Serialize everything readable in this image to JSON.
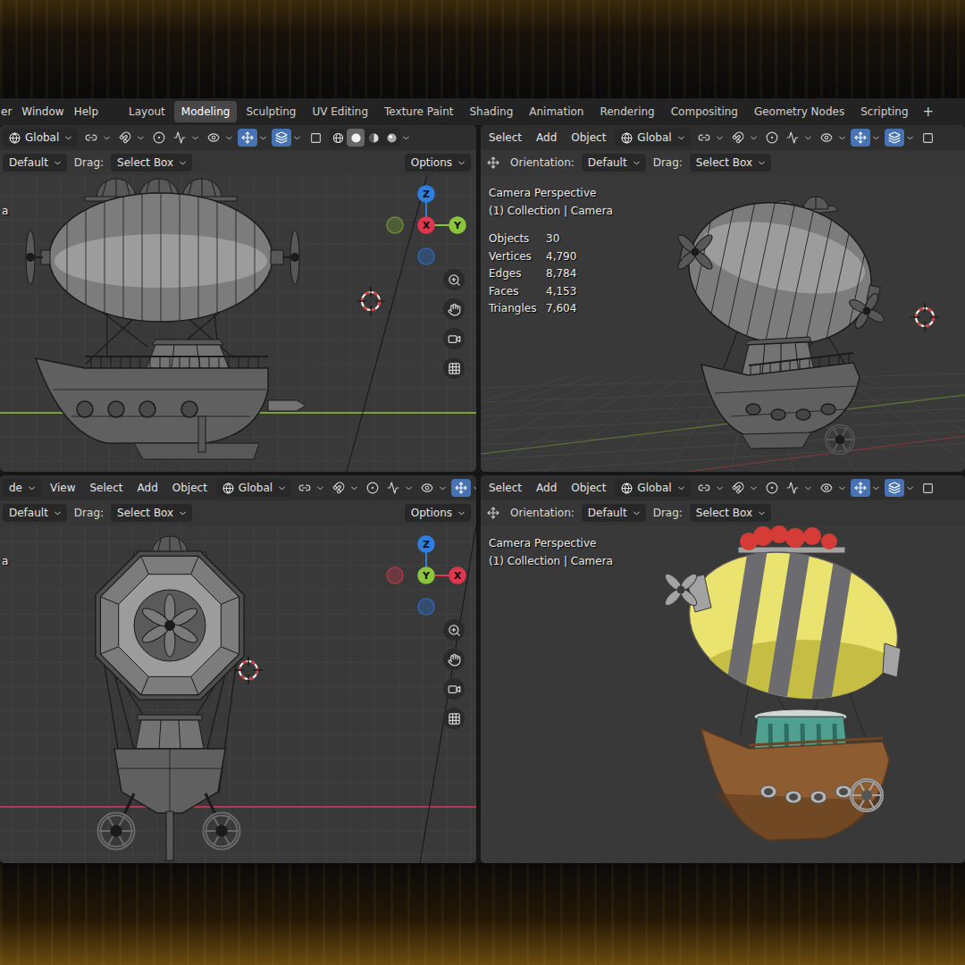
{
  "topbar": {
    "menus": [
      "er",
      "Window",
      "Help"
    ],
    "workspaces": [
      {
        "label": "Layout",
        "selected": false
      },
      {
        "label": "Modeling",
        "selected": true
      },
      {
        "label": "Sculpting",
        "selected": false
      },
      {
        "label": "UV Editing",
        "selected": false
      },
      {
        "label": "Texture Paint",
        "selected": false
      },
      {
        "label": "Shading",
        "selected": false
      },
      {
        "label": "Animation",
        "selected": false
      },
      {
        "label": "Rendering",
        "selected": false
      },
      {
        "label": "Compositing",
        "selected": false
      },
      {
        "label": "Geometry Nodes",
        "selected": false
      },
      {
        "label": "Scripting",
        "selected": false
      }
    ],
    "add_workspace": "+"
  },
  "viewports": [
    {
      "header": {
        "menus": [],
        "orientation": "Global",
        "gizmos_on": true,
        "overlays_on": true,
        "xray_on": false,
        "shading": [
          {
            "mode": "wireframe",
            "selected": false
          },
          {
            "mode": "solid",
            "selected": true
          },
          {
            "mode": "material",
            "selected": false
          },
          {
            "mode": "rendered",
            "selected": false
          }
        ]
      },
      "tool_settings": {
        "items": [
          {
            "kind": "dropdown",
            "text": "Default"
          },
          {
            "kind": "label",
            "text": "Drag:"
          },
          {
            "kind": "dropdown",
            "text": "Select Box"
          }
        ],
        "options": "Options"
      },
      "edge_text": "a",
      "gizmo": {
        "axes": [
          {
            "label": "Z",
            "direction": "up",
            "color": "#2f7fe0"
          },
          {
            "direction": "down",
            "color": "#2f64b0"
          },
          {
            "direction": "left",
            "color": "#6b8a35"
          },
          {
            "label": "Y",
            "direction": "right",
            "color": "#8cc43c"
          },
          {
            "label": "X",
            "direction": "center",
            "color": "#e0364f"
          }
        ]
      },
      "grid": "ortho",
      "cursor_visible": true,
      "model": {
        "view": "side",
        "shading": "solid"
      }
    },
    {
      "header": {
        "menus": [
          "Select",
          "Add",
          "Object"
        ],
        "orientation": "Global",
        "gizmos_on": true,
        "overlays_on": true,
        "xray_on": false
      },
      "tool_settings": {
        "items": [
          {
            "kind": "label",
            "text": "Orientation:"
          },
          {
            "kind": "dropdown",
            "text": "Default"
          },
          {
            "kind": "label",
            "text": "Drag:"
          },
          {
            "kind": "dropdown",
            "text": "Select Box"
          }
        ]
      },
      "overlay": {
        "lines": [
          "Camera Perspective",
          "(1) Collection | Camera"
        ],
        "stats": [
          {
            "label": "Objects",
            "value": "30"
          },
          {
            "label": "Vertices",
            "value": "4,790"
          },
          {
            "label": "Edges",
            "value": "8,784"
          },
          {
            "label": "Faces",
            "value": "4,153"
          },
          {
            "label": "Triangles",
            "value": "7,604"
          }
        ]
      },
      "grid": "perspective",
      "cursor_visible": true,
      "model": {
        "view": "perspective",
        "shading": "solid"
      }
    },
    {
      "header": {
        "mode": "de",
        "menus": [
          "View",
          "Select",
          "Add",
          "Object"
        ],
        "orientation": "Global",
        "gizmos_on": true,
        "overlays_on": true,
        "xray_on": false
      },
      "tool_settings": {
        "items": [
          {
            "kind": "dropdown",
            "text": "Default"
          },
          {
            "kind": "label",
            "text": "Drag:"
          },
          {
            "kind": "dropdown",
            "text": "Select Box"
          }
        ],
        "options": "Options"
      },
      "edge_text": "a",
      "gizmo": {
        "axes": [
          {
            "label": "Z",
            "direction": "up",
            "color": "#2f7fe0"
          },
          {
            "direction": "down",
            "color": "#2f64b0"
          },
          {
            "direction": "left",
            "color": "#a8394a"
          },
          {
            "label": "X",
            "direction": "right",
            "color": "#e0364f"
          },
          {
            "label": "Y",
            "direction": "center",
            "color": "#8cc43c"
          }
        ]
      },
      "grid": "ortho",
      "cursor_visible": true,
      "model": {
        "view": "front",
        "shading": "solid"
      }
    },
    {
      "header": {
        "menus": [
          "Select",
          "Add",
          "Object"
        ],
        "orientation": "Global",
        "gizmos_on": true,
        "overlays_on": true,
        "xray_on": false
      },
      "tool_settings": {
        "items": [
          {
            "kind": "label",
            "text": "Orientation:"
          },
          {
            "kind": "dropdown",
            "text": "Default"
          },
          {
            "kind": "label",
            "text": "Drag:"
          },
          {
            "kind": "dropdown",
            "text": "Select Box"
          }
        ]
      },
      "overlay": {
        "lines": [
          "Camera Perspective",
          "(1) Collection | Camera"
        ]
      },
      "grid": "none",
      "cursor_visible": false,
      "model": {
        "view": "perspective",
        "shading": "material"
      }
    }
  ]
}
